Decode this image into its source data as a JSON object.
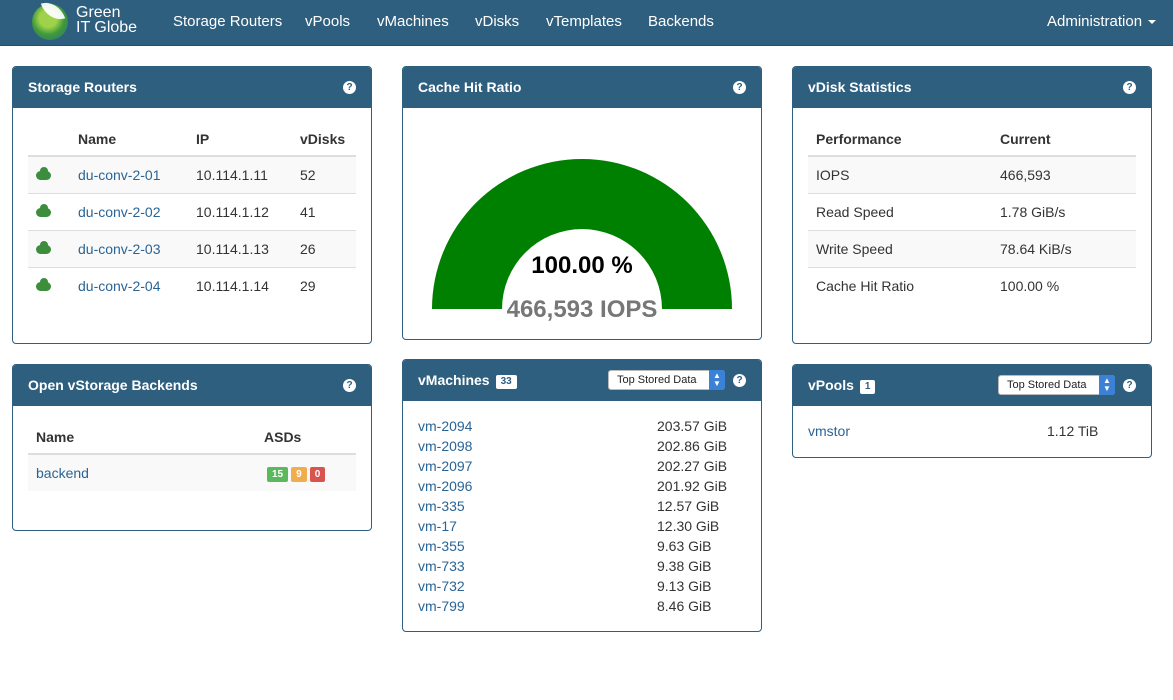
{
  "nav": {
    "logo_text": "Green\nIT Globe",
    "items": [
      "Storage Routers",
      "vPools",
      "vMachines",
      "vDisks",
      "vTemplates",
      "Backends"
    ],
    "admin": "Administration"
  },
  "storage_routers": {
    "title": "Storage Routers",
    "columns": [
      "Name",
      "IP",
      "vDisks"
    ],
    "rows": [
      {
        "name": "du-conv-2-01",
        "ip": "10.114.1.11",
        "vdisks": "52"
      },
      {
        "name": "du-conv-2-02",
        "ip": "10.114.1.12",
        "vdisks": "41"
      },
      {
        "name": "du-conv-2-03",
        "ip": "10.114.1.13",
        "vdisks": "26"
      },
      {
        "name": "du-conv-2-04",
        "ip": "10.114.1.14",
        "vdisks": "29"
      }
    ]
  },
  "cache_hit": {
    "title": "Cache Hit Ratio",
    "ratio_label": "100.00 %",
    "ratio_percent": 100,
    "iops_label": "466,593 IOPS",
    "gauge_color": "#008000"
  },
  "vdisk_stats": {
    "title": "vDisk Statistics",
    "columns": [
      "Performance",
      "Current"
    ],
    "rows": [
      {
        "metric": "IOPS",
        "value": "466,593"
      },
      {
        "metric": "Read Speed",
        "value": "1.78 GiB/s"
      },
      {
        "metric": "Write Speed",
        "value": "78.64 KiB/s"
      },
      {
        "metric": "Cache Hit Ratio",
        "value": "100.00 %"
      }
    ]
  },
  "backends": {
    "title": "Open vStorage Backends",
    "columns": [
      "Name",
      "ASDs"
    ],
    "rows": [
      {
        "name": "backend",
        "asd_green": "15",
        "asd_orange": "9",
        "asd_red": "0"
      }
    ]
  },
  "vmachines": {
    "title": "vMachines",
    "count": "33",
    "select_value": "Top Stored Data",
    "rows": [
      {
        "name": "vm-2094",
        "size": "203.57 GiB"
      },
      {
        "name": "vm-2098",
        "size": "202.86 GiB"
      },
      {
        "name": "vm-2097",
        "size": "202.27 GiB"
      },
      {
        "name": "vm-2096",
        "size": "201.92 GiB"
      },
      {
        "name": "vm-335",
        "size": "12.57 GiB"
      },
      {
        "name": "vm-17",
        "size": "12.30 GiB"
      },
      {
        "name": "vm-355",
        "size": "9.63 GiB"
      },
      {
        "name": "vm-733",
        "size": "9.38 GiB"
      },
      {
        "name": "vm-732",
        "size": "9.13 GiB"
      },
      {
        "name": "vm-799",
        "size": "8.46 GiB"
      }
    ]
  },
  "vpools": {
    "title": "vPools",
    "count": "1",
    "select_value": "Top Stored Data",
    "rows": [
      {
        "name": "vmstor",
        "size": "1.12 TiB"
      }
    ]
  },
  "icons": {
    "help": "question-circle-icon",
    "storage_router": "cloud-icon",
    "select_arrows": "updown-chevron-icon"
  }
}
